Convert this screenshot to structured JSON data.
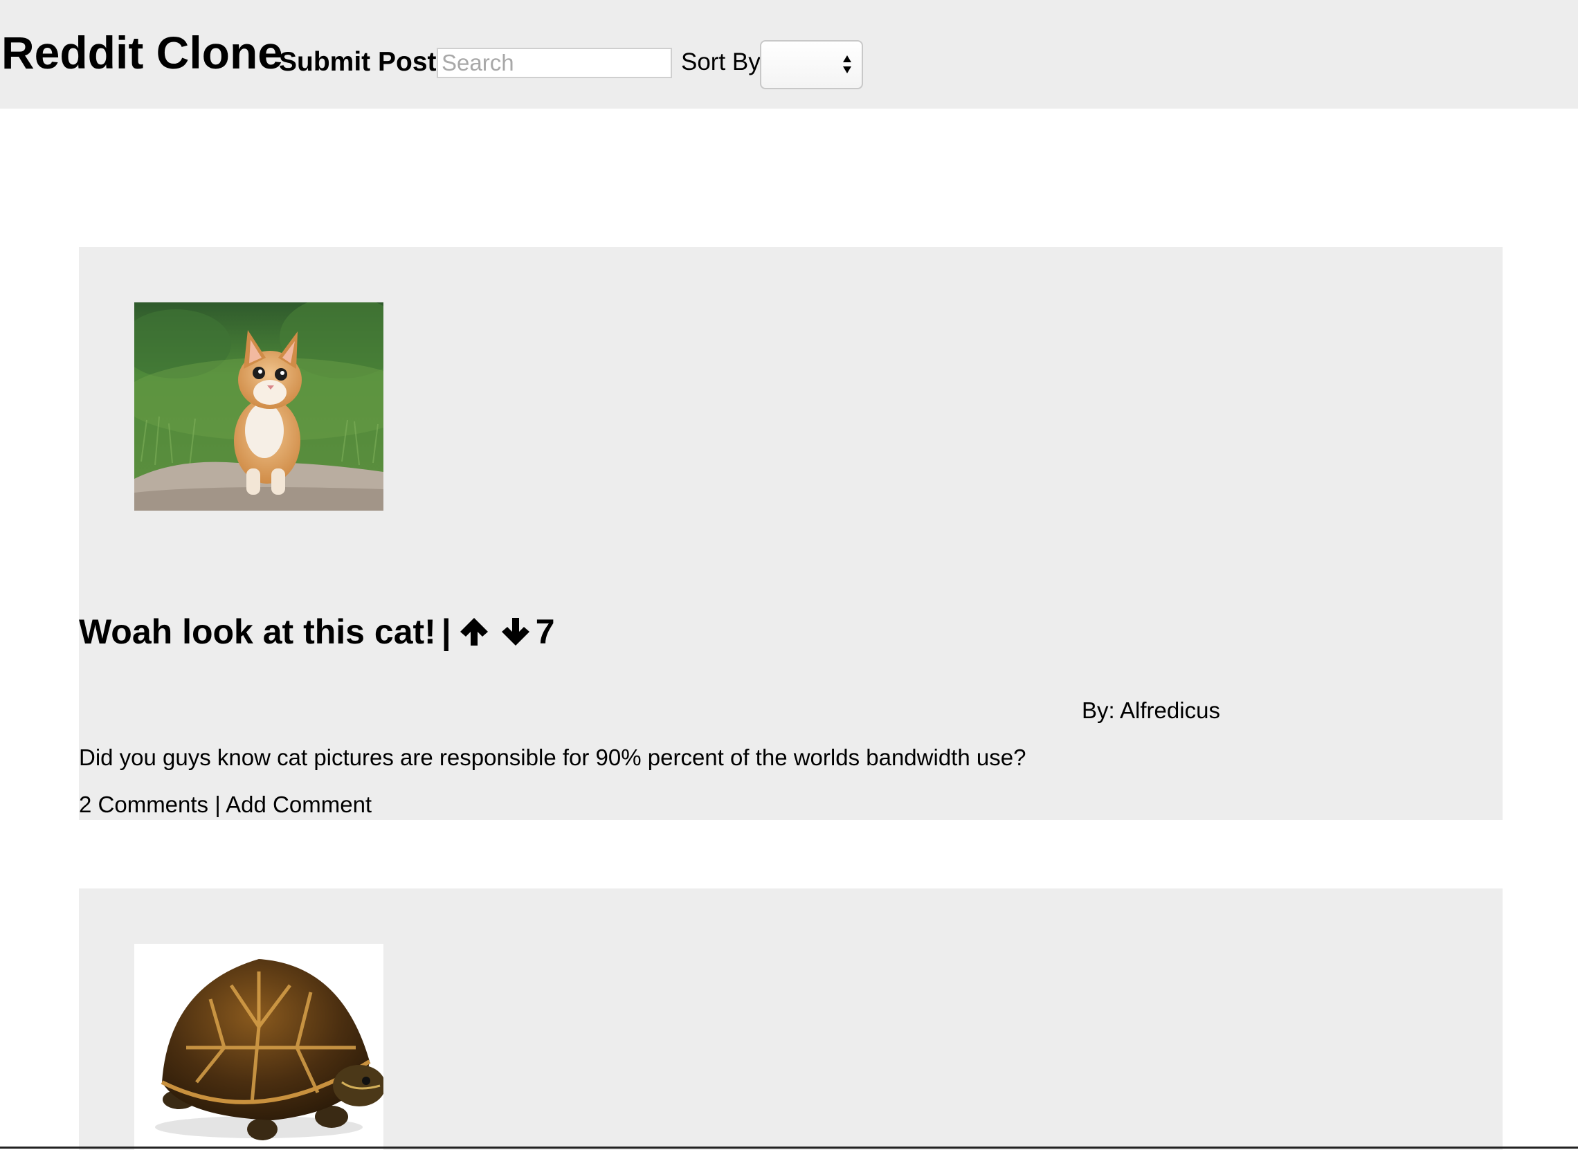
{
  "header": {
    "brand": "Reddit Clone",
    "submit_label": "Submit Post",
    "search": {
      "placeholder": "Search",
      "value": ""
    },
    "sort": {
      "label": "Sort By",
      "selected": ""
    }
  },
  "posts": [
    {
      "image": "kitten-photo",
      "title": "Woah look at this cat!",
      "separator": "|",
      "votes": "7",
      "author_prefix": "By:",
      "author": "Alfredicus",
      "body": "Did you guys know cat pictures are responsible for 90% percent of the worlds bandwidth use?",
      "comments_label": "2 Comments",
      "links_separator": "|",
      "add_comment_label": "Add Comment"
    },
    {
      "image": "turtle-photo"
    }
  ],
  "icons": {
    "upvote": "arrow-up-icon",
    "downvote": "arrow-down-icon",
    "select_arrows": "chevron-up-down-icon"
  },
  "colors": {
    "header_background": "#ededed",
    "post_background": "#ededed",
    "page_background": "#ffffff",
    "text": "#000000",
    "placeholder": "#a8a8a8"
  }
}
